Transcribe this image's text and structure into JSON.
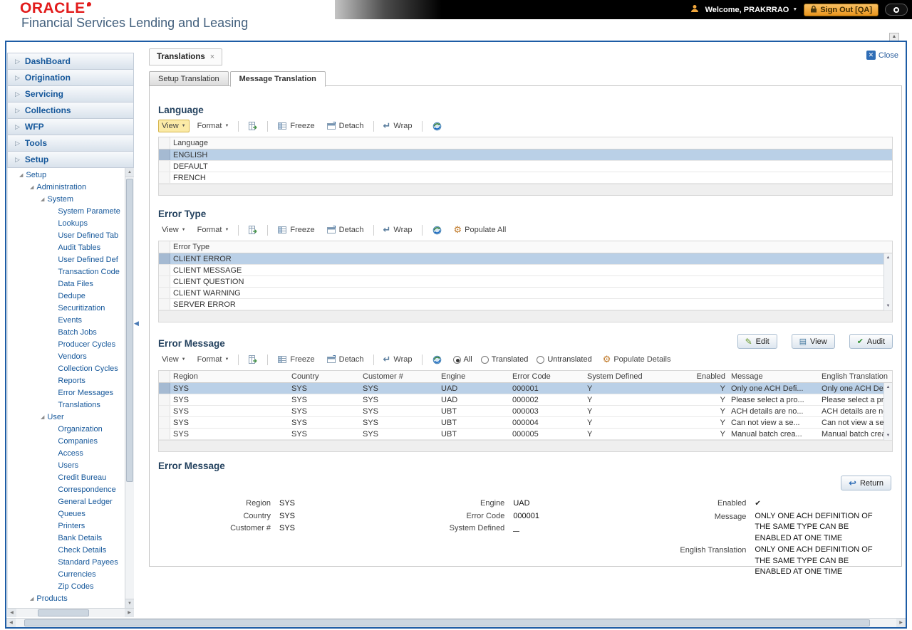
{
  "header": {
    "logo": "ORACLE",
    "product": "Financial Services Lending and Leasing",
    "welcome": "Welcome, PRAKRRAO",
    "sign_out": "Sign Out [QA]"
  },
  "main_tab": {
    "label": "Translations"
  },
  "close_label": "Close",
  "sub_tabs": [
    {
      "label": "Setup Translation"
    },
    {
      "label": "Message Translation"
    }
  ],
  "sidebar": {
    "accordion": [
      {
        "label": "DashBoard"
      },
      {
        "label": "Origination"
      },
      {
        "label": "Servicing"
      },
      {
        "label": "Collections"
      },
      {
        "label": "WFP"
      },
      {
        "label": "Tools"
      },
      {
        "label": "Setup"
      }
    ],
    "tree": [
      {
        "label": "Setup",
        "level": 0,
        "expanded": true
      },
      {
        "label": "Administration",
        "level": 1,
        "expanded": true
      },
      {
        "label": "System",
        "level": 2,
        "expanded": true
      },
      {
        "label": "System Paramete",
        "level": 3
      },
      {
        "label": "Lookups",
        "level": 3
      },
      {
        "label": "User Defined Tab",
        "level": 3
      },
      {
        "label": "Audit Tables",
        "level": 3
      },
      {
        "label": "User Defined Def",
        "level": 3
      },
      {
        "label": "Transaction Code",
        "level": 3
      },
      {
        "label": "Data Files",
        "level": 3
      },
      {
        "label": "Dedupe",
        "level": 3
      },
      {
        "label": "Securitization",
        "level": 3
      },
      {
        "label": "Events",
        "level": 3
      },
      {
        "label": "Batch Jobs",
        "level": 3
      },
      {
        "label": "Producer Cycles",
        "level": 3
      },
      {
        "label": "Vendors",
        "level": 3
      },
      {
        "label": "Collection Cycles",
        "level": 3
      },
      {
        "label": "Reports",
        "level": 3
      },
      {
        "label": "Error Messages",
        "level": 3
      },
      {
        "label": "Translations",
        "level": 3
      },
      {
        "label": "User",
        "level": 2,
        "expanded": true
      },
      {
        "label": "Organization",
        "level": 3
      },
      {
        "label": "Companies",
        "level": 3
      },
      {
        "label": "Access",
        "level": 3
      },
      {
        "label": "Users",
        "level": 3
      },
      {
        "label": "Credit Bureau",
        "level": 3
      },
      {
        "label": "Correspondence",
        "level": 3
      },
      {
        "label": "General Ledger",
        "level": 3
      },
      {
        "label": "Queues",
        "level": 3
      },
      {
        "label": "Printers",
        "level": 3
      },
      {
        "label": "Bank Details",
        "level": 3
      },
      {
        "label": "Check Details",
        "level": 3
      },
      {
        "label": "Standard Payees",
        "level": 3
      },
      {
        "label": "Currencies",
        "level": 3
      },
      {
        "label": "Zip Codes",
        "level": 3
      },
      {
        "label": "Products",
        "level": 1,
        "expanded": true
      }
    ]
  },
  "language_section": {
    "title": "Language",
    "toolbar": {
      "view": "View",
      "format": "Format",
      "freeze": "Freeze",
      "detach": "Detach",
      "wrap": "Wrap"
    },
    "column": "Language",
    "rows": [
      {
        "label": "ENGLISH",
        "selected": true
      },
      {
        "label": "DEFAULT"
      },
      {
        "label": "FRENCH"
      }
    ]
  },
  "error_type_section": {
    "title": "Error Type",
    "toolbar": {
      "view": "View",
      "format": "Format",
      "freeze": "Freeze",
      "detach": "Detach",
      "wrap": "Wrap",
      "populate_all": "Populate All"
    },
    "column": "Error Type",
    "rows": [
      {
        "label": "CLIENT ERROR",
        "selected": true
      },
      {
        "label": "CLIENT MESSAGE"
      },
      {
        "label": "CLIENT QUESTION"
      },
      {
        "label": "CLIENT WARNING"
      },
      {
        "label": "SERVER ERROR"
      }
    ]
  },
  "error_message_section": {
    "title": "Error Message",
    "actions": [
      {
        "label": "Edit"
      },
      {
        "label": "View"
      },
      {
        "label": "Audit"
      }
    ],
    "toolbar": {
      "view": "View",
      "format": "Format",
      "freeze": "Freeze",
      "detach": "Detach",
      "wrap": "Wrap",
      "populate_details": "Populate Details"
    },
    "filters": [
      {
        "label": "All",
        "checked": true
      },
      {
        "label": "Translated",
        "checked": false
      },
      {
        "label": "Untranslated",
        "checked": false
      }
    ],
    "columns": [
      "Region",
      "Country",
      "Customer #",
      "Engine",
      "Error Code",
      "System Defined",
      "Enabled",
      "Message",
      "English Translation"
    ],
    "rows": [
      {
        "region": "SYS",
        "country": "SYS",
        "customer": "SYS",
        "engine": "UAD",
        "error_code": "000001",
        "system_defined": "Y",
        "enabled": "Y",
        "message": "Only one ACH Defi...",
        "english_translation": "Only one ACH Defi...",
        "selected": true
      },
      {
        "region": "SYS",
        "country": "SYS",
        "customer": "SYS",
        "engine": "UAD",
        "error_code": "000002",
        "system_defined": "Y",
        "enabled": "Y",
        "message": "Please select a pro...",
        "english_translation": "Please select a pro..."
      },
      {
        "region": "SYS",
        "country": "SYS",
        "customer": "SYS",
        "engine": "UBT",
        "error_code": "000003",
        "system_defined": "Y",
        "enabled": "Y",
        "message": "ACH details are no...",
        "english_translation": "ACH details are no..."
      },
      {
        "region": "SYS",
        "country": "SYS",
        "customer": "SYS",
        "engine": "UBT",
        "error_code": "000004",
        "system_defined": "Y",
        "enabled": "Y",
        "message": "Can not view a se...",
        "english_translation": "Can not view a se..."
      },
      {
        "region": "SYS",
        "country": "SYS",
        "customer": "SYS",
        "engine": "UBT",
        "error_code": "000005",
        "system_defined": "Y",
        "enabled": "Y",
        "message": "Manual batch crea...",
        "english_translation": "Manual batch crea..."
      }
    ]
  },
  "detail_section": {
    "title": "Error Message",
    "return_label": "Return",
    "fields": {
      "region_label": "Region",
      "region": "SYS",
      "country_label": "Country",
      "country": "SYS",
      "customer_label": "Customer #",
      "customer": "SYS",
      "engine_label": "Engine",
      "engine": "UAD",
      "error_code_label": "Error Code",
      "error_code": "000001",
      "system_defined_label": "System Defined",
      "system_defined_checked": false,
      "enabled_label": "Enabled",
      "enabled_checked": true,
      "message_label": "Message",
      "message": "ONLY ONE ACH DEFINITION OF THE SAME TYPE CAN BE ENABLED AT ONE TIME",
      "english_translation_label": "English Translation",
      "english_translation": "ONLY ONE ACH DEFINITION OF THE SAME TYPE CAN BE ENABLED AT ONE TIME"
    }
  },
  "colors": {
    "accent_blue": "#1d5ca5",
    "selected_row": "#bad0e7",
    "signout_orange": "#e8941c",
    "brand_red": "#e21b1b"
  }
}
